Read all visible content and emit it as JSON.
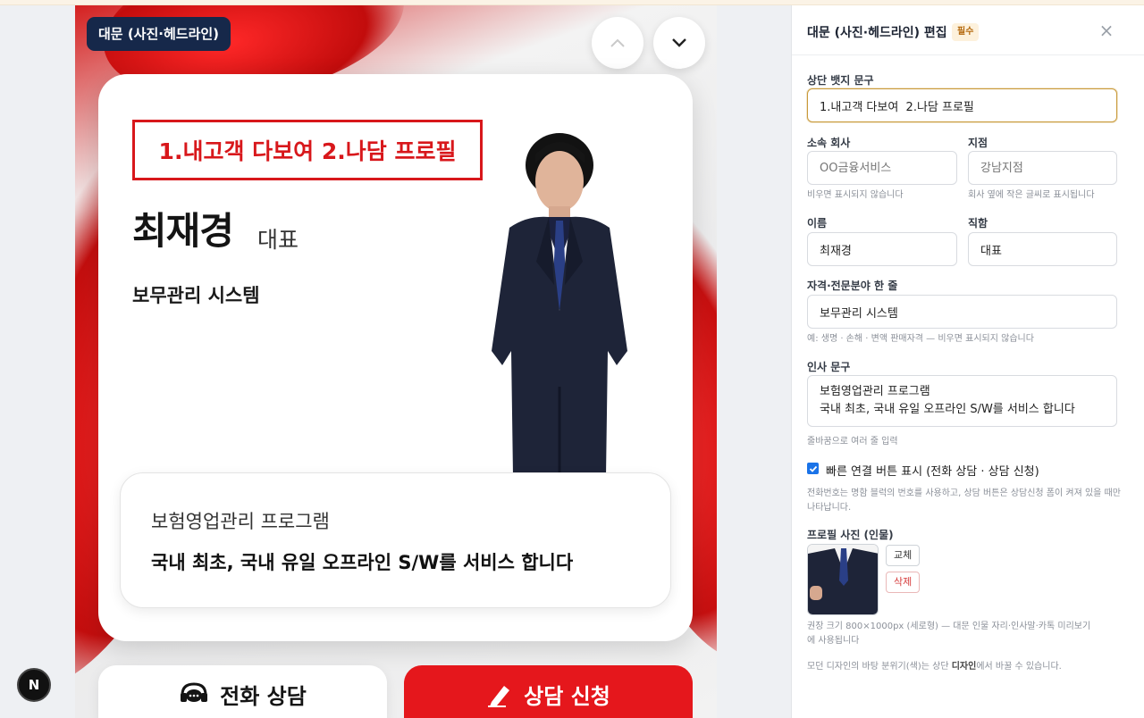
{
  "preview": {
    "section_tag": "대문 (사진·헤드라인)",
    "badge_text": "1.내고객 다보여 2.나담 프로필",
    "person_name": "최재경",
    "person_title": "대표",
    "specialty": "보무관리 시스템",
    "greeting_line1": "보험영업관리 프로그램",
    "greeting_line2": "국내 최초, 국내 유일 오프라인 S/W를 서비스 합니다",
    "call_button": "전화 상담",
    "apply_button": "상담 신청",
    "next_badge": "N"
  },
  "editor": {
    "title": "대문 (사진·헤드라인) 편집",
    "required_badge": "필수",
    "close_label": "×",
    "badge_label": "상단 뱃지 문구",
    "badge_value": "1.내고객 다보여  2.나담 프로필",
    "company_label": "소속 회사",
    "company_placeholder": "OO금융서비스",
    "company_hint": "비우면 표시되지 않습니다",
    "branch_label": "지점",
    "branch_placeholder": "강남지점",
    "branch_hint": "회사 옆에 작은 글씨로 표시됩니다",
    "name_label": "이름",
    "name_value": "최재경",
    "position_label": "직함",
    "position_value": "대표",
    "specialty_label": "자격·전문분야 한 줄",
    "specialty_value": "보무관리 시스템",
    "specialty_hint": "예: 생명 · 손해 · 변액 판매자격 — 비우면 표시되지 않습니다",
    "greeting_label": "인사 문구",
    "greeting_value": "보험영업관리 프로그램\n국내 최초, 국내 유일 오프라인 S/W를 서비스 합니다",
    "greeting_hint": "줄바꿈으로 여러 줄 입력",
    "quick_label": "빠른 연결 버튼 표시 (전화 상담 · 상담 신청)",
    "quick_checked": true,
    "quick_hint": "전화번호는 명함 블럭의 번호를 사용하고, 상담 버튼은 상담신청 폼이 켜져 있을 때만 나타납니다.",
    "photo_label": "프로필 사진 (인물)",
    "replace_button": "교체",
    "delete_button": "삭제",
    "photo_hint": "권장 크기 800×1000px (세로형) — 대문 인물 자리·인사말·카톡 미리보기에 사용됩니다",
    "footer_prefix": "모던 디자인의 바탕 분위기(색)는 상단 ",
    "footer_bold": "디자인",
    "footer_suffix": "에서 바꿀 수 있습니다."
  },
  "colors": {
    "accent_red": "#e5171c",
    "navy_tag": "#16284a",
    "checkbox_blue": "#1a73e8",
    "badge_amber": "#b4690e"
  }
}
